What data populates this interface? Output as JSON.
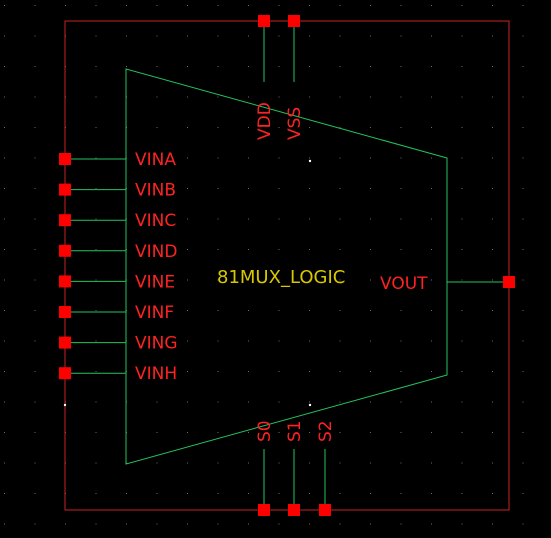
{
  "symbol": {
    "name": "81MUX_LOGIC",
    "colors": {
      "background": "#000000",
      "grid_dot": "#6b6b6b",
      "body_outline": "#22c55e",
      "wire": "#22c55e",
      "boundary": "#cc2222",
      "pin_square": "#ff0000",
      "pin_label": "#ff2222",
      "name_label": "#d8c800"
    },
    "input_pins": [
      "VINA",
      "VINB",
      "VINC",
      "VIND",
      "VINE",
      "VINF",
      "VING",
      "VINH"
    ],
    "output_pin": "VOUT",
    "power_pins": [
      "VDD",
      "VSS"
    ],
    "select_pins": [
      "S0",
      "S1",
      "S2"
    ]
  }
}
